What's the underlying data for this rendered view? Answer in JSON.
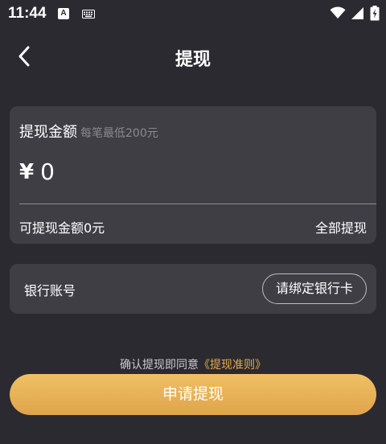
{
  "status_bar": {
    "time": "11:44",
    "notification_badge": "A",
    "icons": [
      "a-notification-icon",
      "keyboard-icon",
      "wifi-icon",
      "signal-icon",
      "battery-icon"
    ]
  },
  "header": {
    "back_icon": "chevron-left-icon",
    "title": "提现"
  },
  "amount_card": {
    "title": "提现金额",
    "hint": "每笔最低200元",
    "currency_symbol": "¥",
    "amount_value": "0",
    "available_text": "可提现金额0元",
    "withdraw_all_label": "全部提现"
  },
  "bank_card": {
    "label": "银行账号",
    "bind_button_label": "请绑定银行卡"
  },
  "agreement": {
    "prefix": "确认提现即同意",
    "link_text": "《提现准则》"
  },
  "submit_button_label": "申请提现",
  "colors": {
    "background": "#2b2a31",
    "card": "#3f3e45",
    "accent_gold": "#e5ac4f",
    "hint_gray": "#8a8990"
  }
}
